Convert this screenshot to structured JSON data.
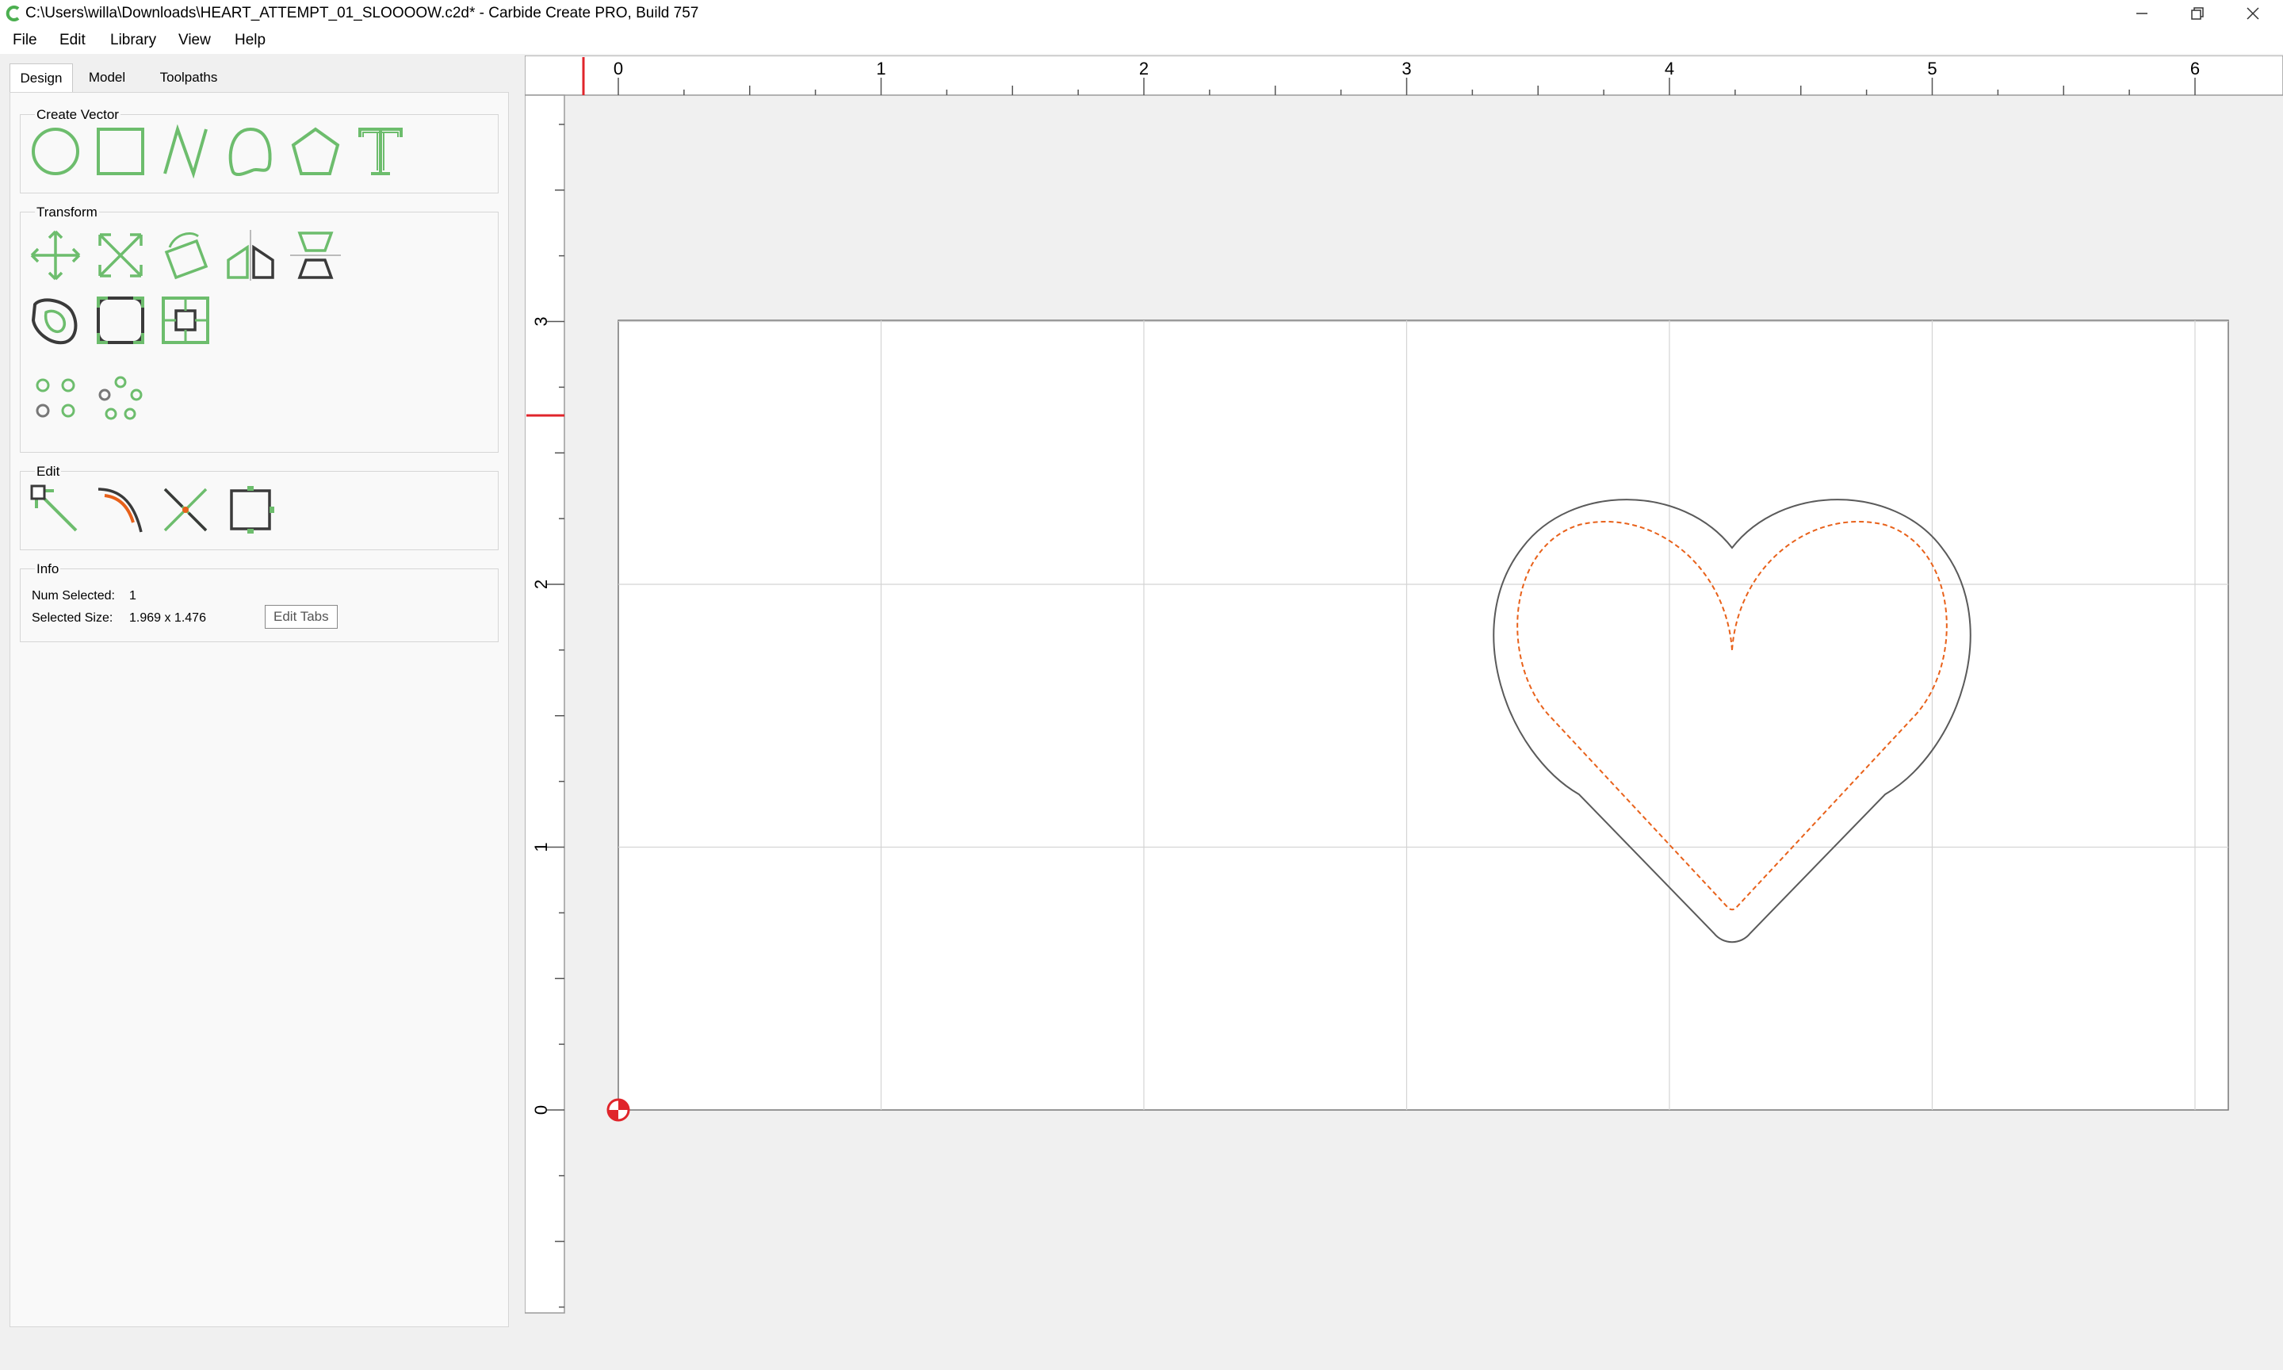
{
  "window": {
    "title": "C:\\Users\\willa\\Downloads\\HEART_ATTEMPT_01_SLOOOOW.c2d* - Carbide Create PRO, Build 757",
    "buttons": [
      "minimize-icon",
      "restore-icon",
      "close-icon"
    ]
  },
  "menu": {
    "file": "File",
    "edit": "Edit",
    "library": "Library",
    "view": "View",
    "help": "Help"
  },
  "tabs": {
    "design": "Design",
    "model": "Model",
    "toolpaths": "Toolpaths",
    "active": "Design"
  },
  "groups": {
    "create_vector": "Create Vector",
    "transform": "Transform",
    "edit": "Edit",
    "info": "Info"
  },
  "tools": {
    "create_vector": [
      "circle-icon",
      "rectangle-icon",
      "polyline-icon",
      "curve-icon",
      "polygon-icon",
      "text-icon"
    ],
    "transform": [
      "move-icon",
      "scale-icon",
      "rotate-icon",
      "mirror-icon",
      "align-icon",
      "offset-icon",
      "fillet-icon",
      "boolean-icon",
      "circular-array-icon",
      "radial-array-icon"
    ],
    "edit": [
      "node-edit-icon",
      "trim-icon",
      "cut-icon",
      "edit-tabs-icon"
    ]
  },
  "tooltip": "Edit Tabs",
  "info": {
    "num_selected_label": "Num Selected:",
    "num_selected_value": "1",
    "selected_size_label": "Selected Size:",
    "selected_size_value": "1.969 x 1.476"
  },
  "canvas": {
    "x_ruler_labels": [
      "0",
      "1",
      "2",
      "3",
      "4",
      "5",
      "6"
    ],
    "y_ruler_labels": [
      "0",
      "1",
      "2",
      "3"
    ],
    "colors": {
      "background": "#f0f0f0",
      "stock": "#ffffff",
      "grid": "#d4d4d4",
      "heart_outline": "#5a5a5a",
      "toolpath": "#e8611a",
      "cursor_marker": "#e0252b",
      "tool_green": "#6dbd6d",
      "tool_dark": "#3a3a3a"
    }
  }
}
